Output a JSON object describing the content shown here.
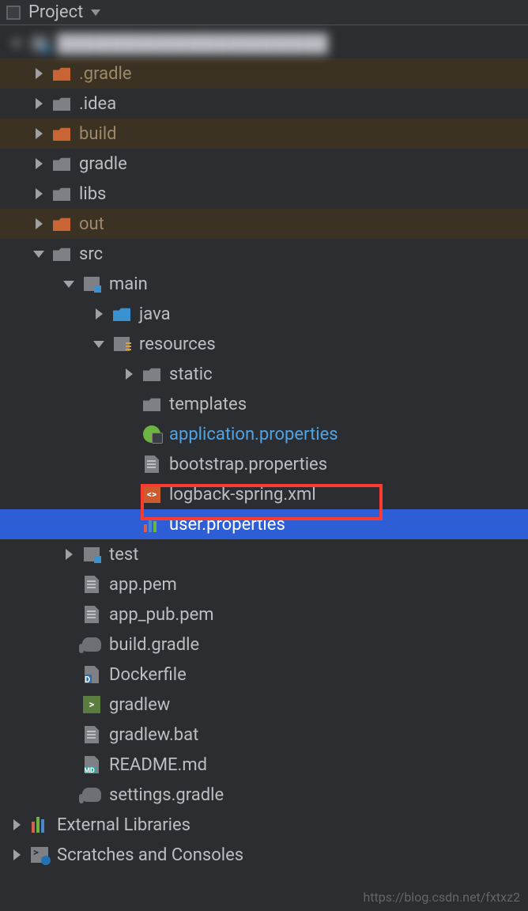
{
  "header": {
    "title": "Project"
  },
  "tree": {
    "root_blurred": true,
    "folders": {
      "gradle_dir": ".gradle",
      "idea_dir": ".idea",
      "build": "build",
      "gradle": "gradle",
      "libs": "libs",
      "out": "out",
      "src": "src",
      "main": "main",
      "java": "java",
      "resources": "resources",
      "static": "static",
      "templates": "templates",
      "test": "test"
    },
    "files": {
      "app_properties": "application.properties",
      "bootstrap": "bootstrap.properties",
      "logback": "logback-spring.xml",
      "user_props": "user.properties",
      "app_pem": "app.pem",
      "app_pub_pem": "app_pub.pem",
      "build_gradle": "build.gradle",
      "dockerfile": "Dockerfile",
      "gradlew": "gradlew",
      "gradlew_bat": "gradlew.bat",
      "readme": "README.md",
      "settings_gradle": "settings.gradle"
    },
    "external_libraries": "External Libraries",
    "scratches": "Scratches and Consoles"
  },
  "watermark": "https://blog.csdn.net/fxtxz2"
}
